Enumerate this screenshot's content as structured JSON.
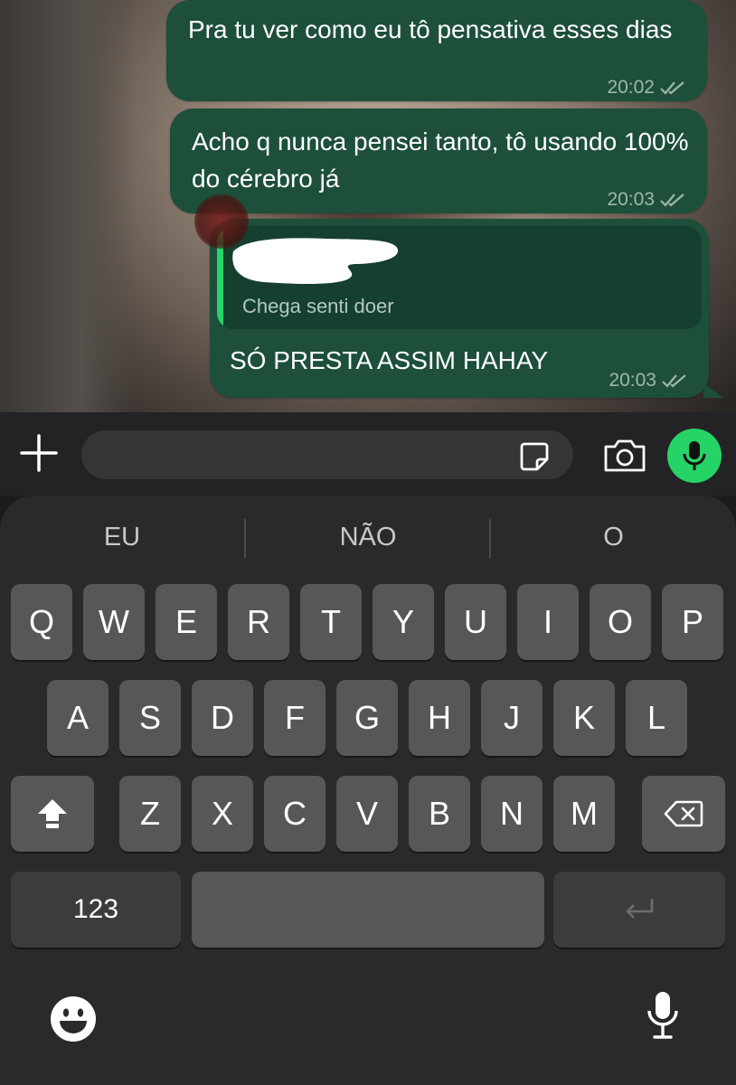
{
  "chat": {
    "messages": [
      {
        "text": "Pra tu ver como eu tô pensativa esses dias",
        "time": "20:02"
      },
      {
        "text": "Acho q nunca pensei tanto, tô usando 100% do cérebro já",
        "time": "20:03"
      },
      {
        "quoted_text": "Chega senti doer",
        "text": "SÓ PRESTA ASSIM HAHAY",
        "time": "20:03"
      }
    ]
  },
  "composer": {
    "input_value": "",
    "icons": [
      "plus-icon",
      "sticker-icon",
      "camera-icon",
      "microphone-icon"
    ],
    "mic_color": "#25d366"
  },
  "keyboard": {
    "suggestions": [
      "EU",
      "NÃO",
      "O"
    ],
    "row1": [
      "Q",
      "W",
      "E",
      "R",
      "T",
      "Y",
      "U",
      "I",
      "O",
      "P"
    ],
    "row2": [
      "A",
      "S",
      "D",
      "F",
      "G",
      "H",
      "J",
      "K",
      "L"
    ],
    "row3": [
      "Z",
      "X",
      "C",
      "V",
      "B",
      "N",
      "M"
    ],
    "numbers_label": "123",
    "icons": [
      "shift-icon",
      "backspace-icon",
      "return-icon",
      "emoji-icon",
      "dictation-icon"
    ]
  },
  "colors": {
    "bubble_outgoing": "#1d4f3a",
    "quote_bar": "#25d366",
    "keyboard_bg": "#2a2a2c"
  }
}
